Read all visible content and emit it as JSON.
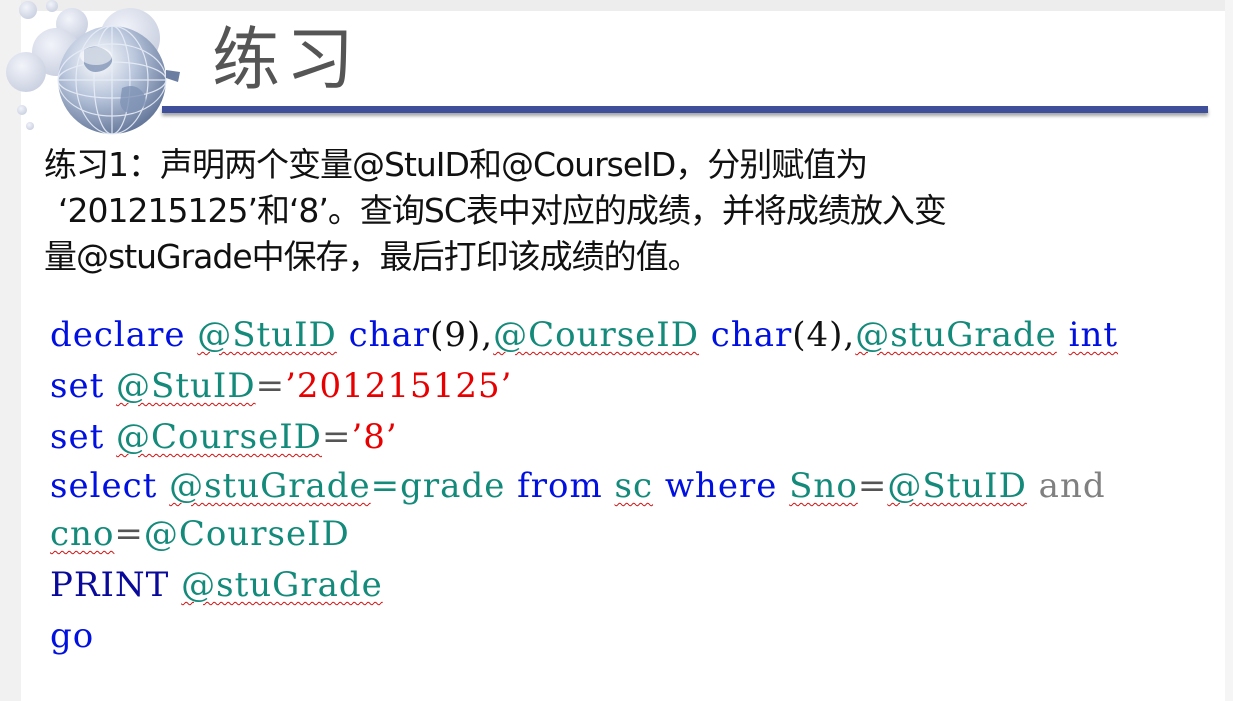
{
  "slide": {
    "title": "练习"
  },
  "exercise": {
    "line1": "练习1：声明两个变量@StuID和@CourseID，分别赋值为",
    "line2": "‘201215125’和‘8’。查询SC表中对应的成绩，并将成绩放入变",
    "line3": "量@stuGrade中保存，最后打印该成绩的值。"
  },
  "code": {
    "l1": {
      "declare": "declare",
      "stuid": "@StuID",
      "char1": "char",
      "p1": "(9),",
      "courseid": "@CourseID",
      "char2": "char",
      "p2": "(4),",
      "stugrade": "@stuGrade",
      "int": "int"
    },
    "l2": {
      "set": "set",
      "var": "@StuID",
      "eq": "=",
      "val": "’201215125’"
    },
    "l3": {
      "set": "set",
      "var": "@CourseID",
      "eq": "=",
      "val": "’8’"
    },
    "l4": {
      "select": "select",
      "var": "@stuGrade",
      "assign": "=grade",
      "from": "from",
      "table": "sc",
      "where": "where",
      "col": "Sno",
      "eq": "=",
      "ref": "@StuID",
      "and": "and"
    },
    "l5": {
      "col": "cno",
      "eq": "=",
      "ref": "@CourseID"
    },
    "l6": {
      "print": "PRINT",
      "var": "@stuGrade"
    },
    "l7": {
      "go": "go"
    }
  },
  "colors": {
    "keyword": "#0010e0",
    "variable": "#138a7a",
    "string": "#e80000",
    "title_rule": "#3f4f9a",
    "title_text": "#555555"
  },
  "icons": {
    "logo": "globe-logo-icon"
  }
}
